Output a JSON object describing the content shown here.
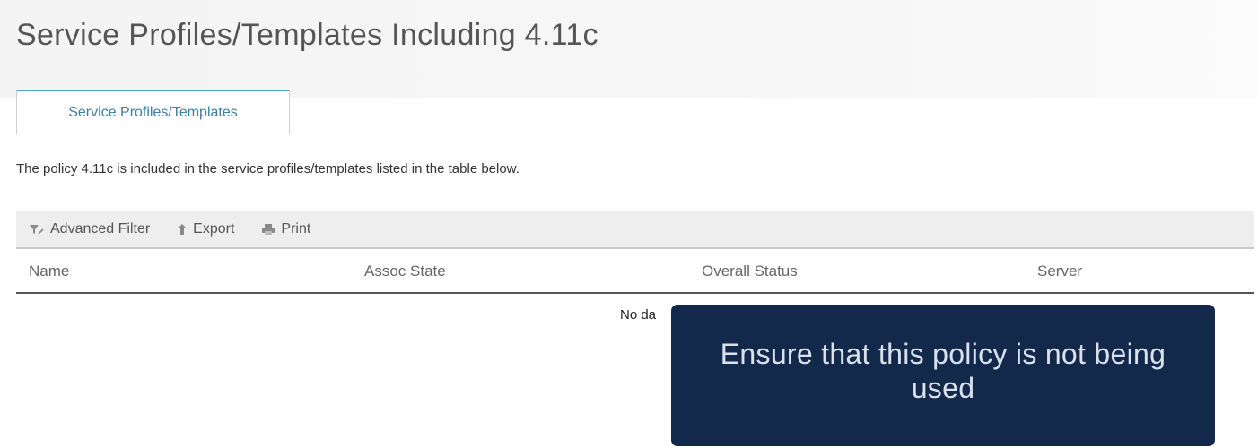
{
  "page": {
    "title": "Service Profiles/Templates Including 4.11c"
  },
  "tabs": [
    {
      "label": "Service Profiles/Templates",
      "active": true
    }
  ],
  "description": "The policy 4.11c is included in the service profiles/templates listed in the table below.",
  "toolbar": {
    "advanced_filter_label": "Advanced Filter",
    "advanced_filter_icon": "filter-icon",
    "export_label": "Export",
    "export_icon": "arrow-up-icon",
    "print_label": "Print",
    "print_icon": "printer-icon"
  },
  "table": {
    "columns": [
      "Name",
      "Assoc State",
      "Overall Status",
      "Server"
    ],
    "rows": [],
    "empty_text": "No da"
  },
  "callout": {
    "text": "Ensure that this policy is not being used",
    "background_color": "#13294b"
  },
  "colors": {
    "accent": "#49a3c9",
    "tab_text": "#3d7fa5"
  }
}
